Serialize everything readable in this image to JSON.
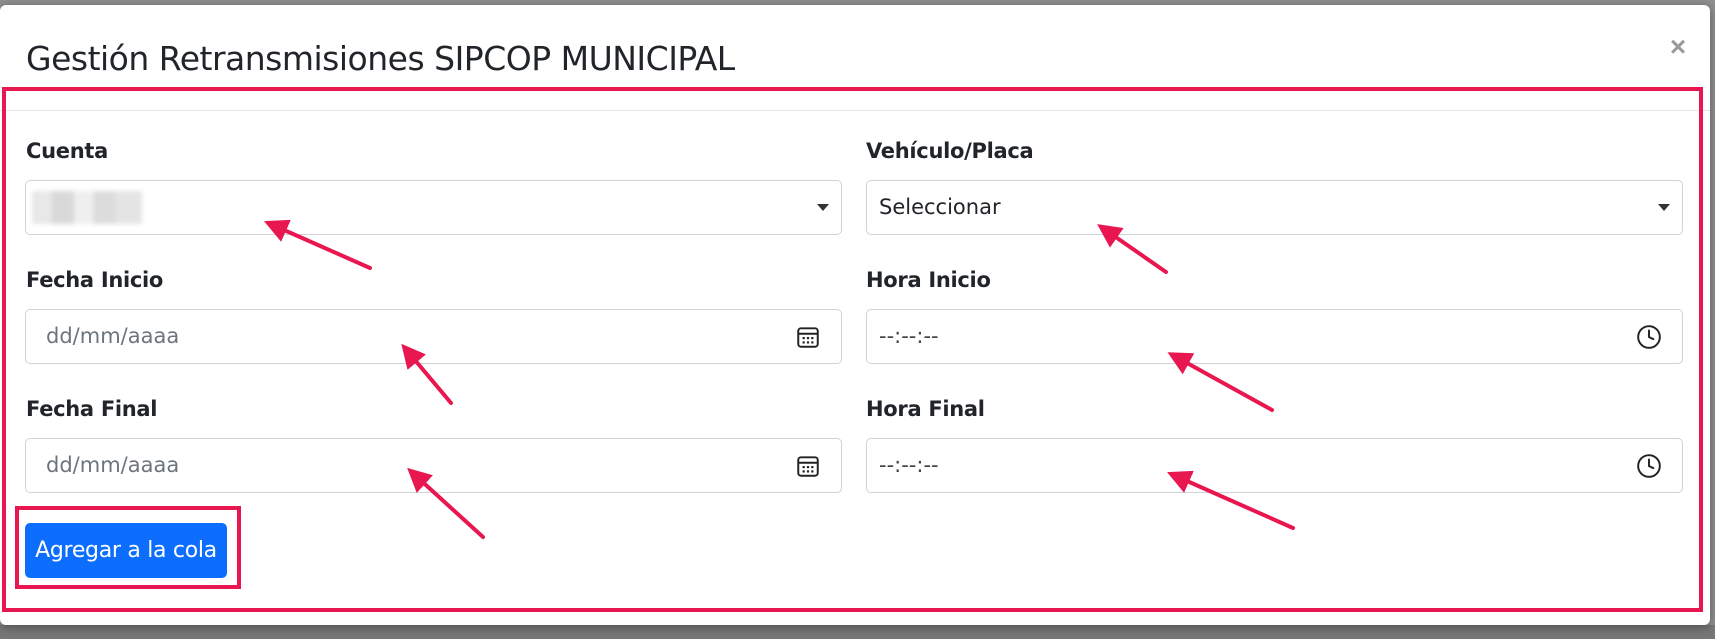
{
  "modal": {
    "title": "Gestión Retransmisiones SIPCOP MUNICIPAL",
    "close_label": "×"
  },
  "form": {
    "cuenta": {
      "label": "Cuenta",
      "value": ""
    },
    "vehiculo": {
      "label": "Vehículo/Placa",
      "value": "Seleccionar"
    },
    "fecha_inicio": {
      "label": "Fecha Inicio",
      "placeholder": "dd/mm/aaaa"
    },
    "hora_inicio": {
      "label": "Hora Inicio",
      "placeholder": "--:--:--"
    },
    "fecha_final": {
      "label": "Fecha Final",
      "placeholder": "dd/mm/aaaa"
    },
    "hora_final": {
      "label": "Hora Final",
      "placeholder": "--:--:--"
    }
  },
  "actions": {
    "add_label": "Agregar a la cola"
  },
  "colors": {
    "primary": "#0d6efd",
    "annotation": "#e8174f"
  }
}
